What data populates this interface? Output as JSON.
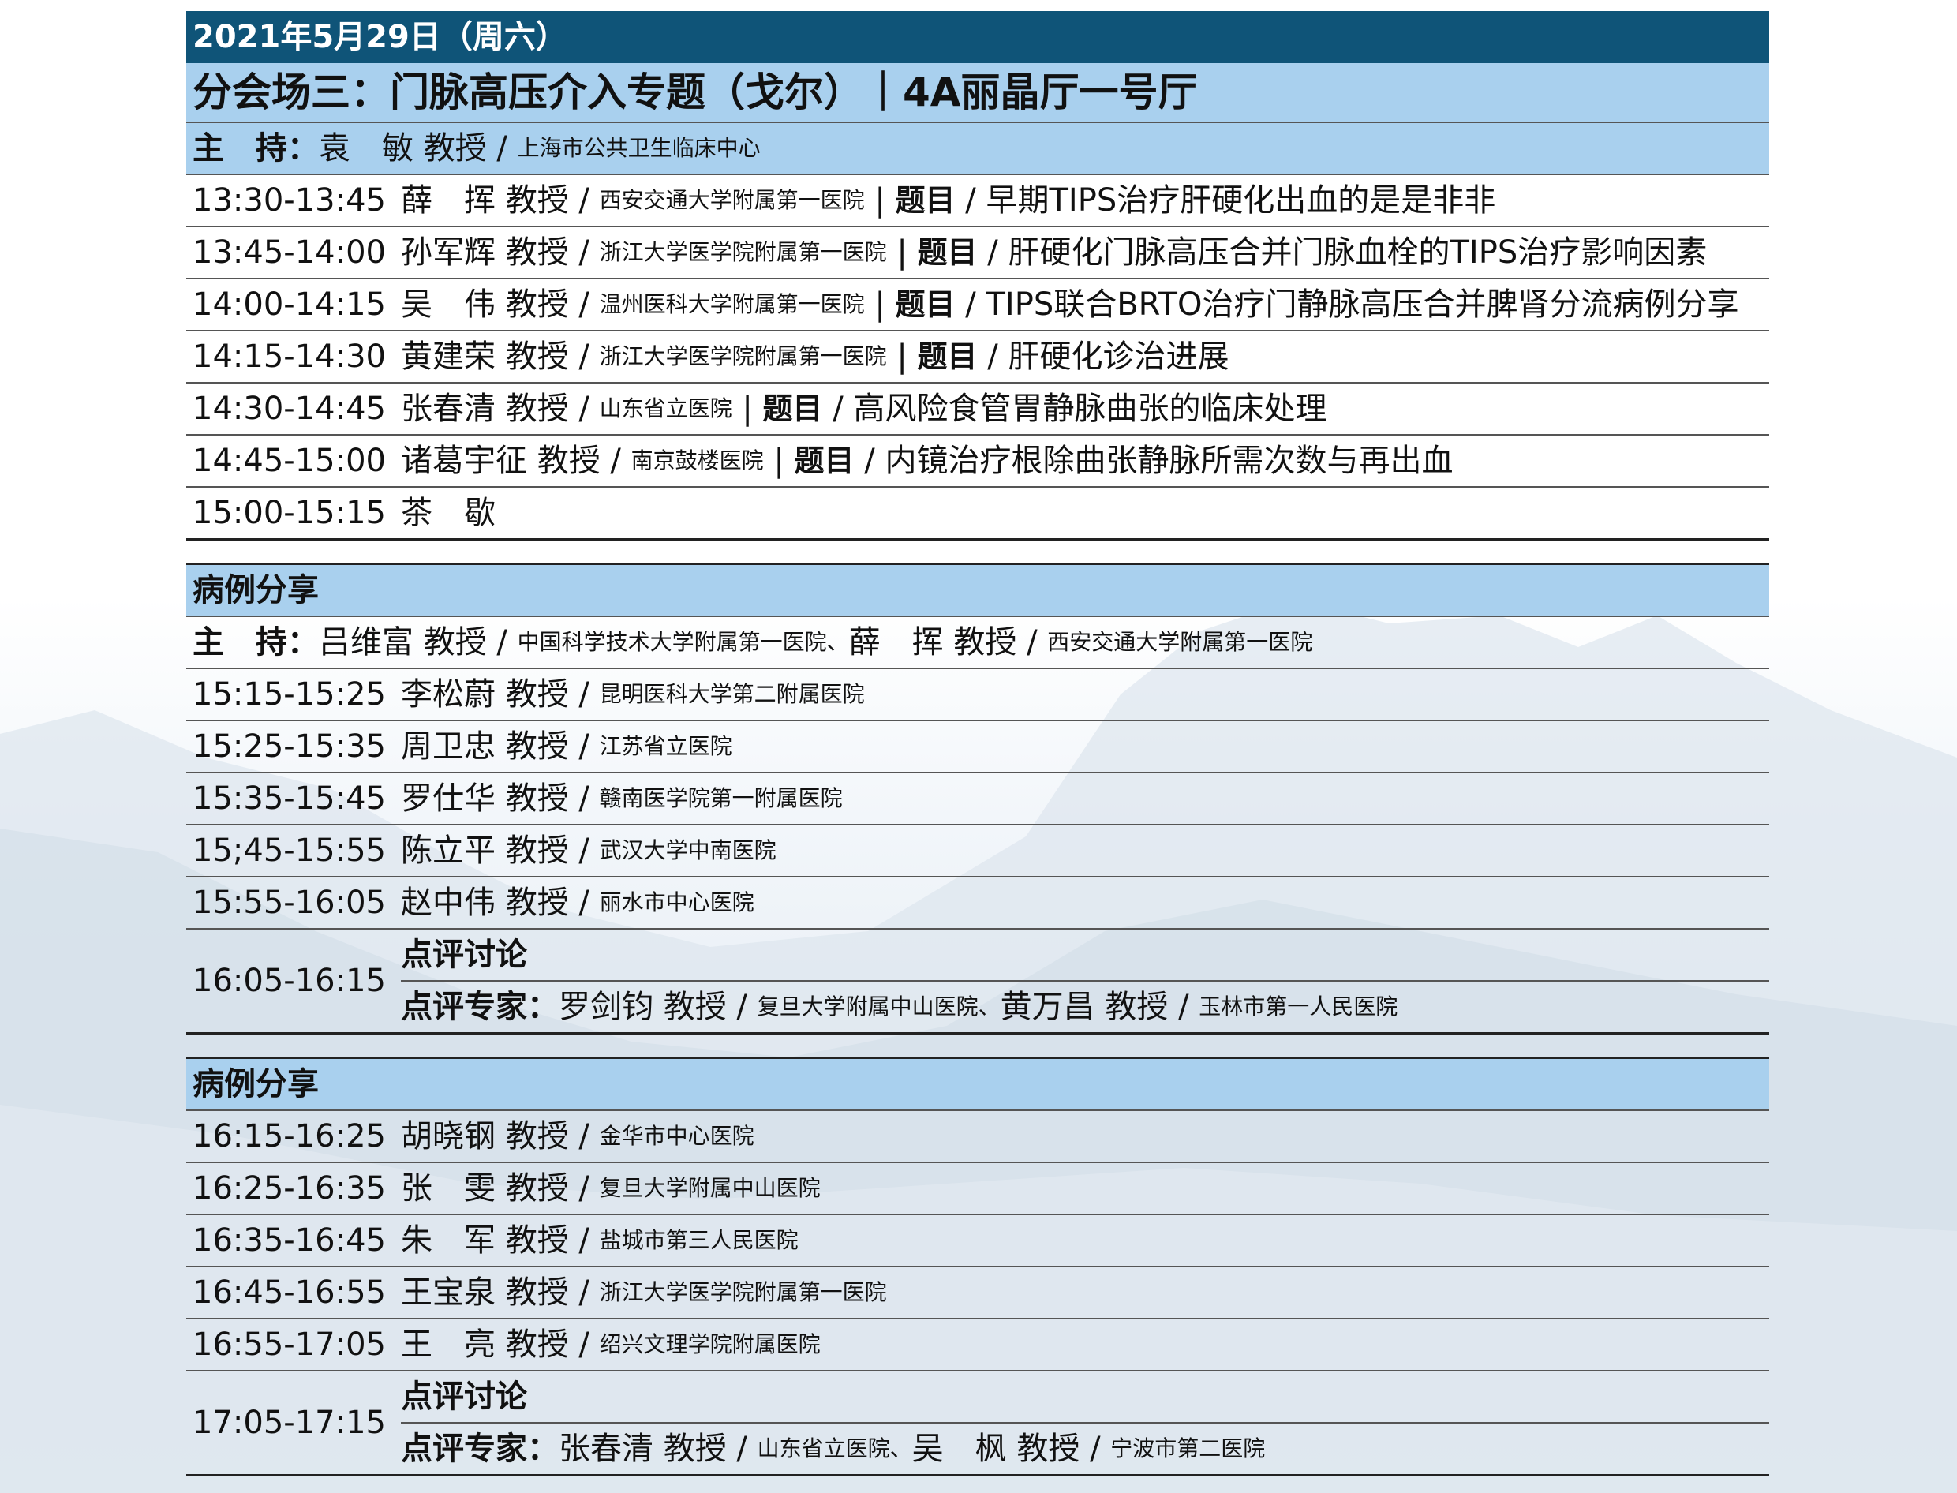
{
  "header": {
    "date": "2021年5月29日（周六）",
    "venue": "分会场三：门脉高压介入专题（戈尔）｜4A丽晶厅一号厅"
  },
  "session1": {
    "host": {
      "label": "主　持：",
      "name": "袁　敏 教授",
      "org": "上海市公共卫生临床中心"
    },
    "rows": [
      {
        "time": "13:30-13:45",
        "name": "薛　挥 教授",
        "org": "西安交通大学附属第一医院",
        "topic_tag": "题目",
        "topic": "早期TIPS治疗肝硬化出血的是是非非"
      },
      {
        "time": "13:45-14:00",
        "name": "孙军辉 教授",
        "org": "浙江大学医学院附属第一医院",
        "topic_tag": "题目",
        "topic": "肝硬化门脉高压合并门脉血栓的TIPS治疗影响因素"
      },
      {
        "time": "14:00-14:15",
        "name": "吴　伟 教授",
        "org": "温州医科大学附属第一医院",
        "topic_tag": "题目",
        "topic": "TIPS联合BRTO治疗门静脉高压合并脾肾分流病例分享"
      },
      {
        "time": "14:15-14:30",
        "name": "黄建荣 教授",
        "org": "浙江大学医学院附属第一医院",
        "topic_tag": "题目",
        "topic": "肝硬化诊治进展"
      },
      {
        "time": "14:30-14:45",
        "name": "张春清 教授",
        "org": "山东省立医院",
        "topic_tag": "题目",
        "topic": "高风险食管胃静脉曲张的临床处理"
      },
      {
        "time": "14:45-15:00",
        "name": "诸葛宇征 教授",
        "org": "南京鼓楼医院",
        "topic_tag": "题目",
        "topic": "内镜治疗根除曲张静脉所需次数与再出血"
      },
      {
        "time": "15:00-15:15",
        "name": "茶　歇",
        "org": "",
        "topic_tag": "",
        "topic": ""
      }
    ]
  },
  "session2": {
    "title": "病例分享",
    "host": {
      "label": "主　持：",
      "name1": "吕维富 教授",
      "org1": "中国科学技术大学附属第一医院、",
      "name2": "薛　挥 教授",
      "org2": "西安交通大学附属第一医院"
    },
    "rows": [
      {
        "time": "15:15-15:25",
        "name": "李松蔚 教授",
        "org": "昆明医科大学第二附属医院"
      },
      {
        "time": "15:25-15:35",
        "name": "周卫忠 教授",
        "org": "江苏省立医院"
      },
      {
        "time": "15:35-15:45",
        "name": "罗仕华 教授",
        "org": "赣南医学院第一附属医院"
      },
      {
        "time": "15;45-15:55",
        "name": "陈立平 教授",
        "org": "武汉大学中南医院"
      },
      {
        "time": "15:55-16:05",
        "name": "赵中伟 教授",
        "org": "丽水市中心医院"
      }
    ],
    "discussion": {
      "time": "16:05-16:15",
      "title": "点评讨论",
      "experts_label": "点评专家：",
      "name1": "罗剑钧 教授",
      "org1": "复旦大学附属中山医院、",
      "name2": "黄万昌 教授",
      "org2": "玉林市第一人民医院"
    }
  },
  "session3": {
    "title": "病例分享",
    "rows": [
      {
        "time": "16:15-16:25",
        "name": "胡晓钢 教授",
        "org": "金华市中心医院"
      },
      {
        "time": "16:25-16:35",
        "name": "张　雯 教授",
        "org": "复旦大学附属中山医院"
      },
      {
        "time": "16:35-16:45",
        "name": "朱　军 教授",
        "org": "盐城市第三人民医院"
      },
      {
        "time": "16:45-16:55",
        "name": "王宝泉 教授",
        "org": "浙江大学医学院附属第一医院"
      },
      {
        "time": "16:55-17:05",
        "name": "王　亮 教授",
        "org": "绍兴文理学院附属医院"
      }
    ],
    "discussion": {
      "time": "17:05-17:15",
      "title": "点评讨论",
      "experts_label": "点评专家：",
      "name1": "张春清 教授",
      "org1": "山东省立医院、",
      "name2": "吴　枫 教授",
      "org2": "宁波市第二医院"
    }
  },
  "colors": {
    "date_bar": "#0f5478",
    "header_band": "#a9d0ee"
  }
}
